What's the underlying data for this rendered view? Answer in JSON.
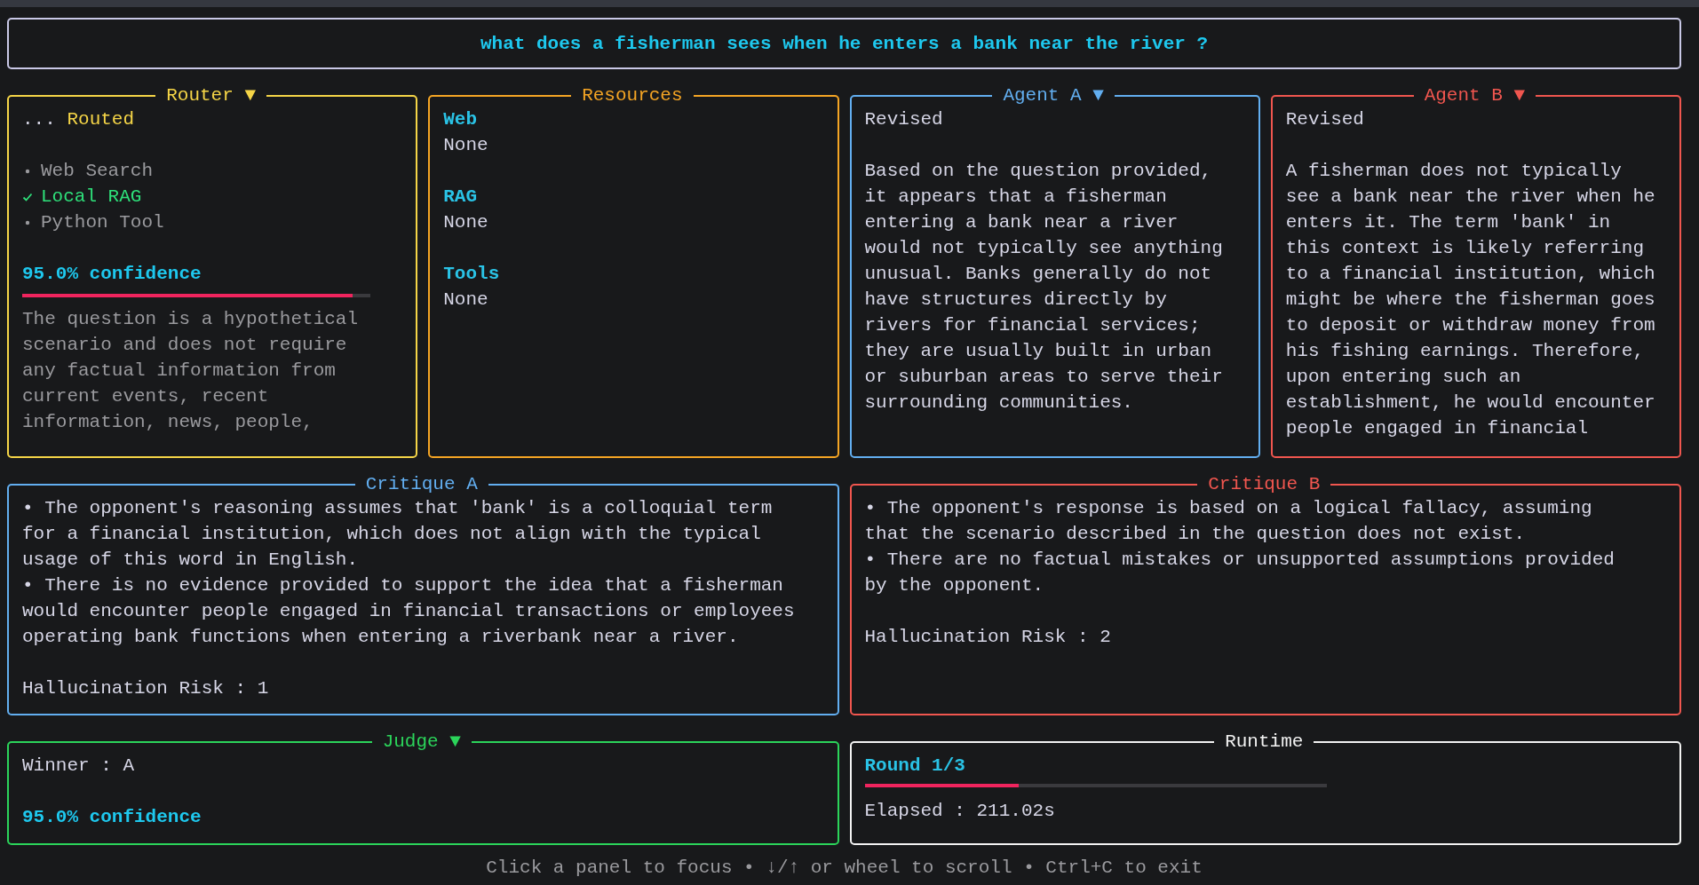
{
  "question": "what does a fisherman sees when he enters a bank near the river ?",
  "router": {
    "title": "Router ▼",
    "color": "#f5d547",
    "status_prefix": "...",
    "status": "Routed",
    "tools": [
      {
        "label": "Web Search",
        "checked": false
      },
      {
        "label": "Local RAG",
        "checked": true
      },
      {
        "label": "Python Tool",
        "checked": false
      }
    ],
    "confidence": "95.0% confidence",
    "level": 0.95,
    "reasoning": "The question is a hypothetical scenario and does not require any factual information from current events, recent information, news, people,"
  },
  "resources": {
    "title": "Resources",
    "color": "#f5a524",
    "sections": [
      {
        "heading": "Web",
        "value": "None"
      },
      {
        "heading": "RAG",
        "value": "None"
      },
      {
        "heading": "Tools",
        "value": "None"
      }
    ]
  },
  "agents": [
    {
      "title": "Agent A ▼",
      "color": "#62aef0",
      "status": "Revised",
      "answer": "Based on the question provided, it appears that a fisherman entering a bank near a river would not typically see anything unusual. Banks generally do not have structures directly by rivers for financial services; they are usually built in urban or suburban areas to serve their surrounding communities."
    },
    {
      "title": "Agent B ▼",
      "color": "#f0564f",
      "status": "Revised",
      "answer": "A fisherman does not typically see a bank near the river when he enters it. The term 'bank' in this context is likely referring to a financial institution, which might be where the fisherman goes to deposit or withdraw money from his fishing earnings. Therefore, upon entering such an establishment, he would encounter people engaged in financial"
    }
  ],
  "critiques": [
    {
      "title": "Critique A",
      "color": "#62aef0",
      "points": [
        "• The opponent's reasoning assumes that 'bank' is a colloquial term for a financial institution, which does not align with the typical usage of this word in English.",
        "• There is no evidence provided to support the idea that a fisherman would encounter people engaged in financial transactions or employees operating bank functions when entering a riverbank near a river."
      ],
      "risk": "Hallucination Risk : 1"
    },
    {
      "title": "Critique B",
      "color": "#f0564f",
      "points": [
        "• The opponent's response is based on a logical fallacy, assuming that the scenario described in the question does not exist.",
        "• There are no factual mistakes or unsupported assumptions provided by the opponent."
      ],
      "risk": "Hallucination Risk : 2"
    }
  ],
  "judge": {
    "title": "Judge ▼",
    "color": "#2bd45a",
    "winner": "Winner : A",
    "confidence": "95.0% confidence"
  },
  "runtime": {
    "title": "Runtime",
    "color": "#f2f2f2",
    "round": "Round 1/3",
    "level": 0.333,
    "elapsed": "Elapsed : 211.02s"
  },
  "footer": "Click a panel to focus • ↓/↑ or wheel to scroll • Ctrl+C to exit"
}
